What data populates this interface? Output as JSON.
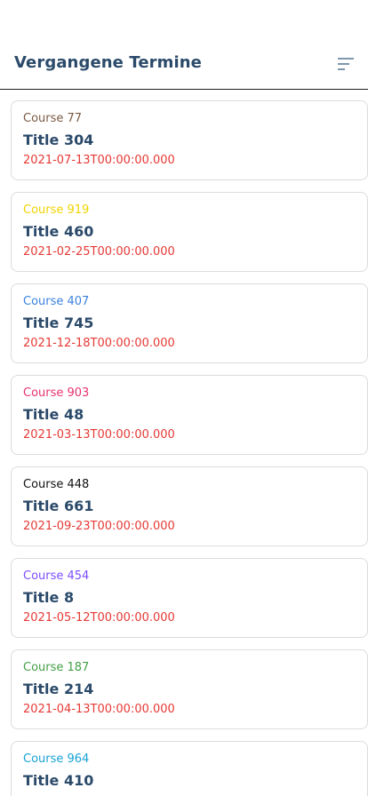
{
  "header": {
    "title": "Vergangene Termine",
    "filter_icon": "filter-list-icon"
  },
  "colors": {
    "title": "#2b4a6a",
    "date": "#e53935",
    "border": "#dcdcdc"
  },
  "appointments": [
    {
      "course": "Course 77",
      "course_color": "#7a5a44",
      "title": "Title 304",
      "date": "2021-07-13T00:00:00.000"
    },
    {
      "course": "Course 919",
      "course_color": "#f0d400",
      "title": "Title 460",
      "date": "2021-02-25T00:00:00.000"
    },
    {
      "course": "Course 407",
      "course_color": "#3b82e0",
      "title": "Title 745",
      "date": "2021-12-18T00:00:00.000"
    },
    {
      "course": "Course 903",
      "course_color": "#e8326e",
      "title": "Title 48",
      "date": "2021-03-13T00:00:00.000"
    },
    {
      "course": "Course 448",
      "course_color": "#111111",
      "title": "Title 661",
      "date": "2021-09-23T00:00:00.000"
    },
    {
      "course": "Course 454",
      "course_color": "#7c4dff",
      "title": "Title 8",
      "date": "2021-05-12T00:00:00.000"
    },
    {
      "course": "Course 187",
      "course_color": "#43a047",
      "title": "Title 214",
      "date": "2021-04-13T00:00:00.000"
    },
    {
      "course": "Course 964",
      "course_color": "#17a2d6",
      "title": "Title 410",
      "date": ""
    }
  ]
}
